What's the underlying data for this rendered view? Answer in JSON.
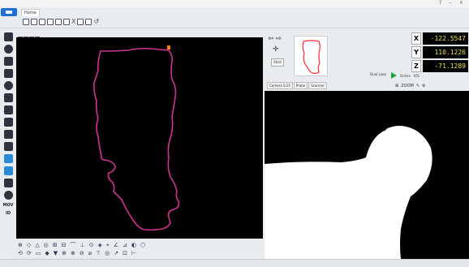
{
  "window": {
    "title": "",
    "controls": [
      "?",
      "–",
      "×"
    ]
  },
  "ribbon": {
    "tabs": [
      "Home",
      "",
      ""
    ],
    "quick_access_symbols": [
      "X",
      "↺"
    ]
  },
  "left_toolbar": {
    "labels": [
      "MOV",
      "ID"
    ]
  },
  "dro": {
    "axes": [
      {
        "axis": "X",
        "value": "-122.5547"
      },
      {
        "axis": "Y",
        "value": "110.1226"
      },
      {
        "axis": "Z",
        "value": "-71.1289"
      }
    ]
  },
  "right_panel": {
    "start_label": "Start",
    "part_label": "Dual Loop",
    "run_labels": [
      "Online",
      "IOS"
    ],
    "zoom_labels": [
      "ZOOM"
    ]
  },
  "camera": {
    "tabs": [
      "Camera 0.25",
      "Probe",
      "Scanner"
    ]
  },
  "colors": {
    "outline_main": "#d0348f",
    "outline_thumb": "#ff2a2a",
    "dro_text": "#e7e04a",
    "accent_blue": "#1e6fd8"
  }
}
